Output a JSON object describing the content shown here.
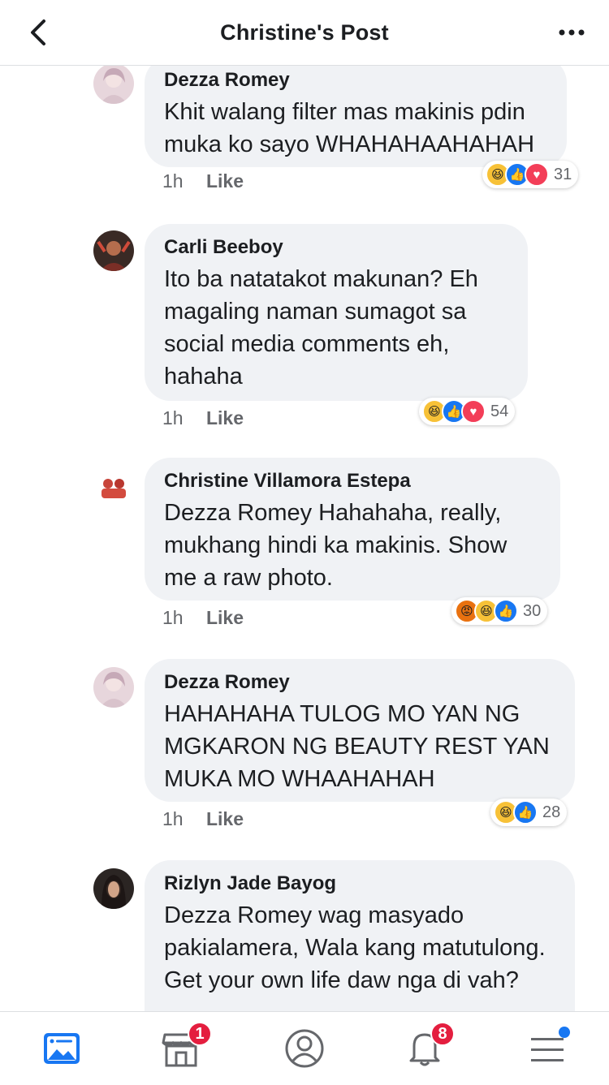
{
  "header": {
    "title": "Christine's Post"
  },
  "comments": [
    {
      "author": "Dezza Romey",
      "text": "Khit walang filter mas makinis pdin muka ko sayo WHAHAHAAHAHAH",
      "time": "1h",
      "like_label": "Like",
      "reactions": [
        "haha",
        "like",
        "love"
      ],
      "reaction_count": "31"
    },
    {
      "author": "Carli Beeboy",
      "text": "Ito ba natatakot makunan? Eh magaling naman sumagot sa social media comments eh, hahaha",
      "time": "1h",
      "like_label": "Like",
      "reactions": [
        "haha",
        "like",
        "love"
      ],
      "reaction_count": "54"
    },
    {
      "author": "Christine Villamora Estepa",
      "text": "Dezza Romey Hahahaha, really, mukhang hindi ka makinis. Show me a raw photo.",
      "time": "1h",
      "like_label": "Like",
      "reactions": [
        "angry",
        "haha",
        "like"
      ],
      "reaction_count": "30"
    },
    {
      "author": "Dezza Romey",
      "text": "HAHAHAHA  TULOG MO YAN NG MGKARON NG BEAUTY REST YAN MUKA MO WHAAHAHAH",
      "time": "1h",
      "like_label": "Like",
      "reactions": [
        "haha",
        "like"
      ],
      "reaction_count": "28"
    },
    {
      "author": "Rizlyn Jade Bayog",
      "text": "Dezza Romey wag masyado pakialamera, Wala kang matutulong. Get your own life daw nga di vah?"
    }
  ],
  "bottom_nav": {
    "items": [
      {
        "icon": "news-feed-icon"
      },
      {
        "icon": "marketplace-icon",
        "badge": "1"
      },
      {
        "icon": "profile-icon"
      },
      {
        "icon": "notifications-icon",
        "badge": "8"
      },
      {
        "icon": "menu-icon"
      }
    ]
  },
  "colors": {
    "accent": "#1877f2",
    "bubble": "#f0f2f5",
    "badge": "#e41e3f",
    "meta_text": "#65676b"
  }
}
